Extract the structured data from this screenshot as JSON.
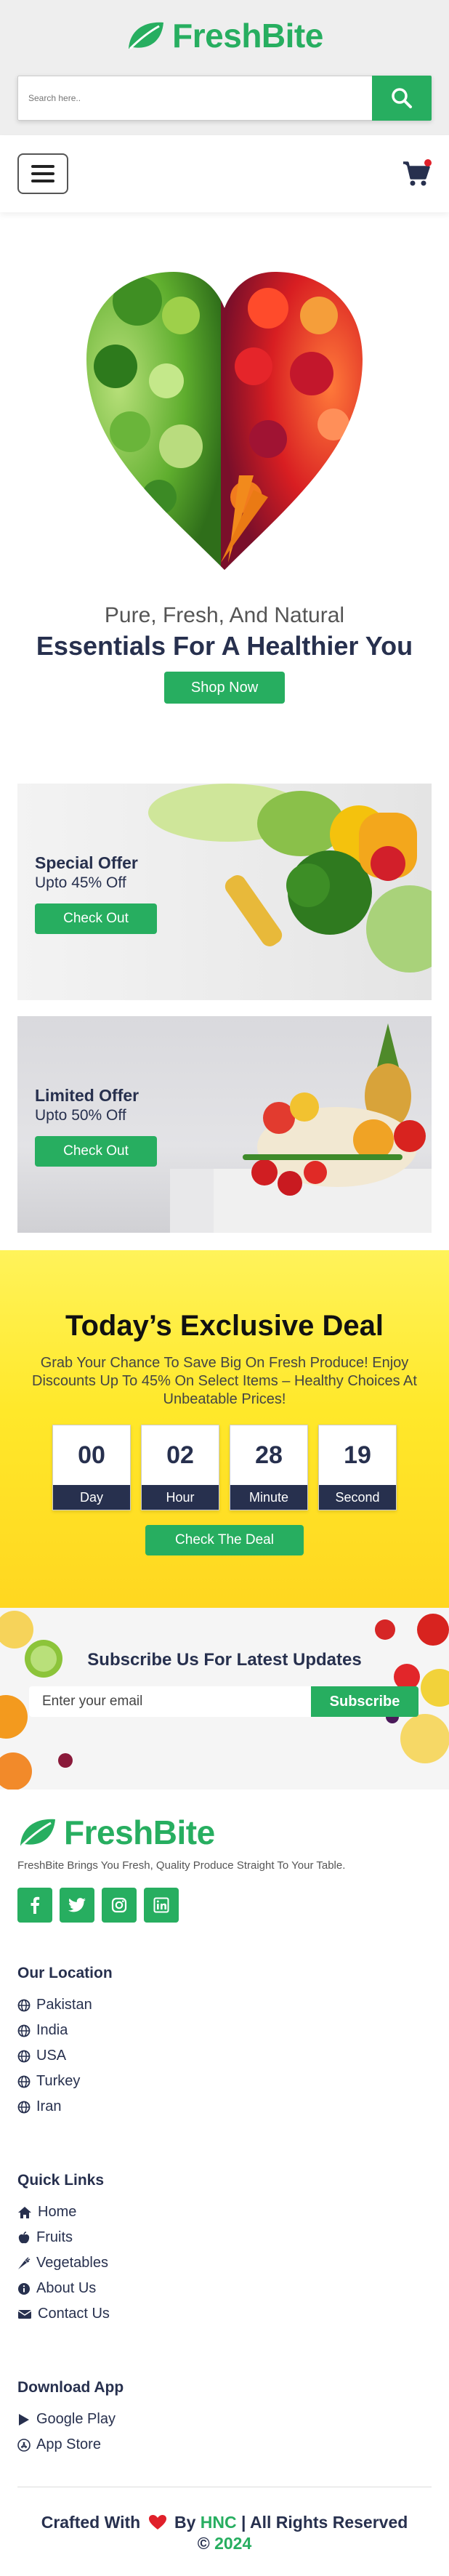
{
  "brand": {
    "name": "FreshBite",
    "color": "#27ae60"
  },
  "search": {
    "placeholder": "Search here.."
  },
  "hero": {
    "subtitle": "Pure, Fresh, And Natural",
    "title": "Essentials For A Healthier You",
    "cta": "Shop Now"
  },
  "offers": [
    {
      "title": "Special Offer",
      "discount": "Upto 45% Off",
      "cta": "Check Out"
    },
    {
      "title": "Limited Offer",
      "discount": "Upto 50% Off",
      "cta": "Check Out"
    }
  ],
  "deal": {
    "title": "Today’s Exclusive Deal",
    "text": "Grab Your Chance To Save Big On Fresh Produce! Enjoy Discounts Up To 45% On Select Items – Healthy Choices At Unbeatable Prices!",
    "countdown": [
      {
        "value": "00",
        "label": "Day"
      },
      {
        "value": "02",
        "label": "Hour"
      },
      {
        "value": "28",
        "label": "Minute"
      },
      {
        "value": "19",
        "label": "Second"
      }
    ],
    "cta": "Check The Deal"
  },
  "subscribe": {
    "title": "Subscribe Us For Latest Updates",
    "placeholder": "Enter your email",
    "button": "Subscribe"
  },
  "footer": {
    "description": "FreshBite Brings You Fresh, Quality Produce Straight To Your Table.",
    "socials": [
      "facebook-icon",
      "twitter-icon",
      "instagram-icon",
      "linkedin-icon"
    ],
    "location": {
      "heading": "Our Location",
      "items": [
        "Pakistan",
        "India",
        "USA",
        "Turkey",
        "Iran"
      ]
    },
    "quick_links": {
      "heading": "Quick Links",
      "items": [
        "Home",
        "Fruits",
        "Vegetables",
        "About Us",
        "Contact Us"
      ]
    },
    "download": {
      "heading": "Download App",
      "items": [
        "Google Play",
        "App Store"
      ]
    },
    "credits": {
      "prefix": "Crafted With",
      "by": "By",
      "author": "HNC",
      "rights": "| All Rights Reserved",
      "copyright": "©",
      "year": "2024"
    }
  }
}
